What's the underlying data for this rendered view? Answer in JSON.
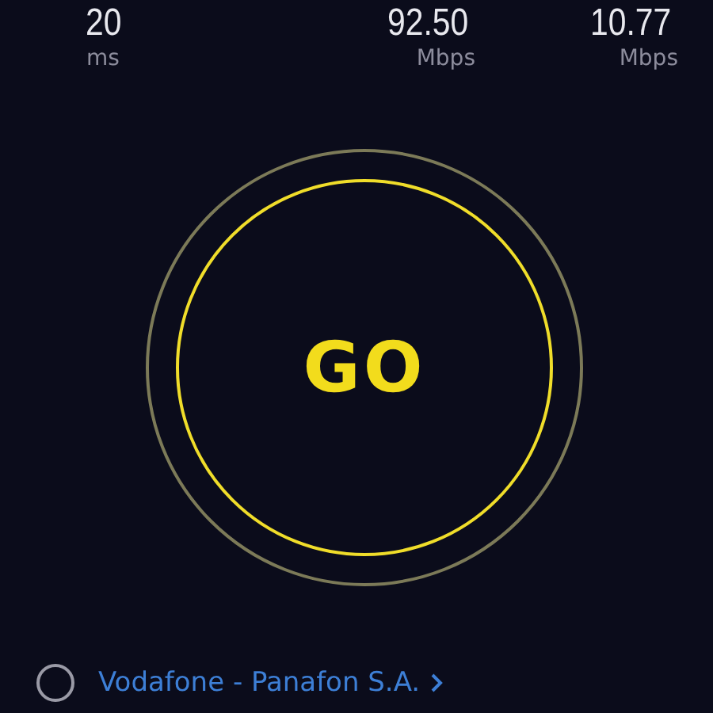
{
  "metrics": [
    {
      "value": "20",
      "unit": "ms"
    },
    {
      "value": "92.50",
      "unit": "Mbps"
    },
    {
      "value": "10.77",
      "unit": "Mbps"
    }
  ],
  "go_button": {
    "label": "GO"
  },
  "provider": {
    "name": "Vodafone - Panafon S.A."
  }
}
